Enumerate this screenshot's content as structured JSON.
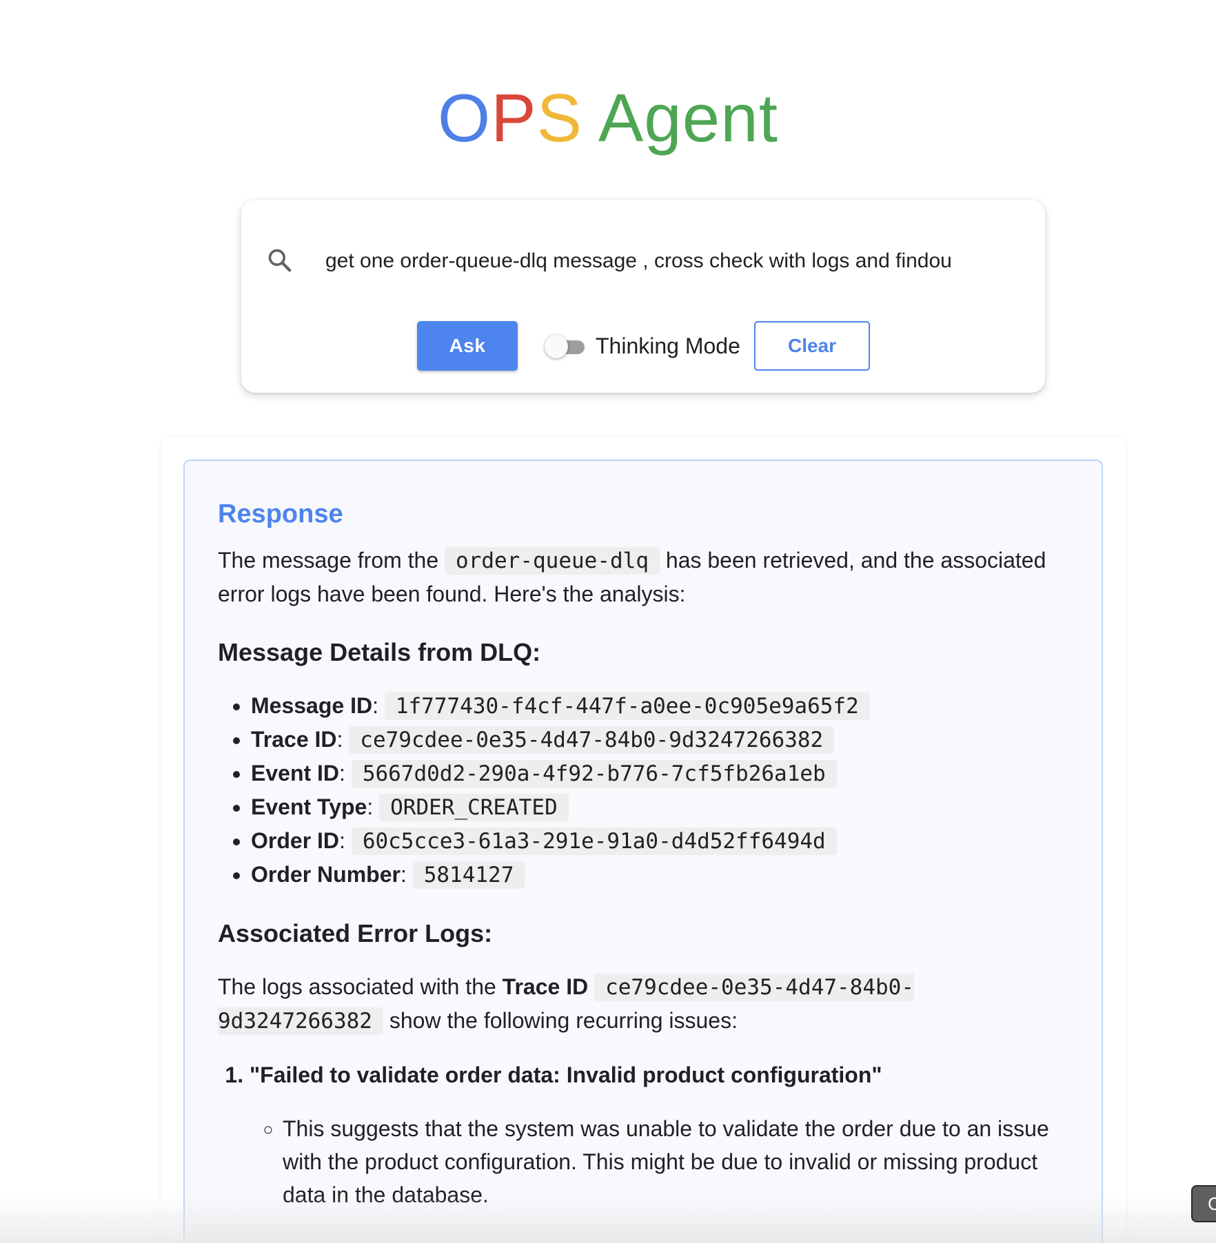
{
  "app": {
    "title_parts": [
      "O",
      "P",
      "S",
      " Agent"
    ],
    "colors": {
      "o": "#4d7fe6",
      "p": "#d8473a",
      "s": "#f0b83a",
      "agent": "#4ea654",
      "accent": "#4d84ed"
    }
  },
  "search": {
    "icon": "search-icon",
    "value": "get one order-queue-dlq message , cross check with logs and findou"
  },
  "controls": {
    "ask_label": "Ask",
    "thinking_label": "Thinking Mode",
    "thinking_enabled": false,
    "clear_label": "Clear"
  },
  "response": {
    "heading": "Response",
    "intro": {
      "before": "The message from the ",
      "code": "order-queue-dlq",
      "after": " has been retrieved, and the associated error logs have been found. Here's the analysis:"
    },
    "details_heading": "Message Details from DLQ:",
    "details": [
      {
        "label": "Message ID",
        "sep": ": ",
        "value": "1f777430-f4cf-447f-a0ee-0c905e9a65f2"
      },
      {
        "label": "Trace ID",
        "sep": ": ",
        "value": "ce79cdee-0e35-4d47-84b0-9d3247266382"
      },
      {
        "label": "Event ID",
        "sep": ": ",
        "value": "5667d0d2-290a-4f92-b776-7cf5fb26a1eb"
      },
      {
        "label": "Event Type",
        "sep": ": ",
        "value": "ORDER_CREATED"
      },
      {
        "label": "Order ID",
        "sep": ": ",
        "value": "60c5cce3-61a3-291e-91a0-d4d52ff6494d"
      },
      {
        "label": "Order Number",
        "sep": ": ",
        "value": "5814127"
      }
    ],
    "logs_heading": "Associated Error Logs:",
    "logs_intro": {
      "before": "The logs associated with the ",
      "bold": "Trace ID",
      "code": "ce79cdee-0e35-4d47-84b0-9d3247266382",
      "after": " show the following recurring issues:"
    },
    "issues": [
      {
        "title": "\"Failed to validate order data: Invalid product configuration\"",
        "notes": [
          "This suggests that the system was unable to validate the order due to an issue with the product configuration. This might be due to invalid or missing product data in the database."
        ]
      }
    ]
  },
  "corner_button": {
    "label": "C"
  }
}
